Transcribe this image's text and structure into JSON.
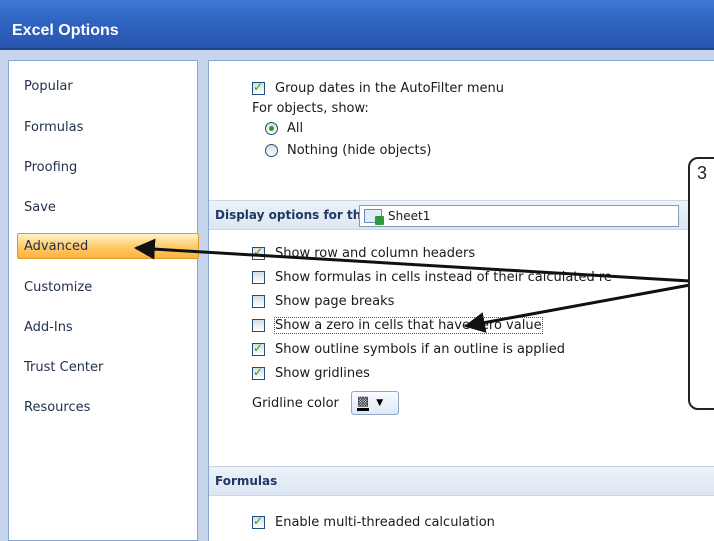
{
  "window": {
    "title": "Excel Options"
  },
  "sidebar": {
    "items": [
      {
        "label": "Popular",
        "active": false
      },
      {
        "label": "Formulas",
        "active": false
      },
      {
        "label": "Proofing",
        "active": false
      },
      {
        "label": "Save",
        "active": false
      },
      {
        "label": "Advanced",
        "active": true
      },
      {
        "label": "Customize",
        "active": false
      },
      {
        "label": "Add-Ins",
        "active": false
      },
      {
        "label": "Trust Center",
        "active": false
      },
      {
        "label": "Resources",
        "active": false
      }
    ]
  },
  "options": {
    "group_dates": {
      "label": "Group dates in the AutoFilter menu",
      "checked": true
    },
    "objects_label": "For objects, show:",
    "objects_all": {
      "label": "All",
      "selected": true
    },
    "objects_nothing": {
      "label": "Nothing (hide objects)",
      "selected": false
    }
  },
  "display_section": {
    "title": "Display options for this worksheet:",
    "sheet_value": "Sheet1",
    "row_col_headers": {
      "label": "Show row and column headers",
      "checked": true
    },
    "formulas_in_cells": {
      "label": "Show formulas in cells instead of their calculated re",
      "checked": false
    },
    "page_breaks": {
      "label": "Show page breaks",
      "checked": false
    },
    "zero_values": {
      "label": "Show a zero in cells that have zero value",
      "checked": false
    },
    "outline_symbols": {
      "label": "Show outline symbols if an outline is applied",
      "checked": true
    },
    "gridlines": {
      "label": "Show gridlines",
      "checked": true
    },
    "gridline_color_label": "Gridline color"
  },
  "formulas_section": {
    "title": "Formulas",
    "multithreaded": {
      "label": "Enable multi-threaded calculation",
      "checked": true
    }
  },
  "callout": {
    "step": "3"
  },
  "colors": {
    "title_bar": "#2f63c0",
    "active_tab": "#ffc866",
    "check": "#21a121"
  }
}
